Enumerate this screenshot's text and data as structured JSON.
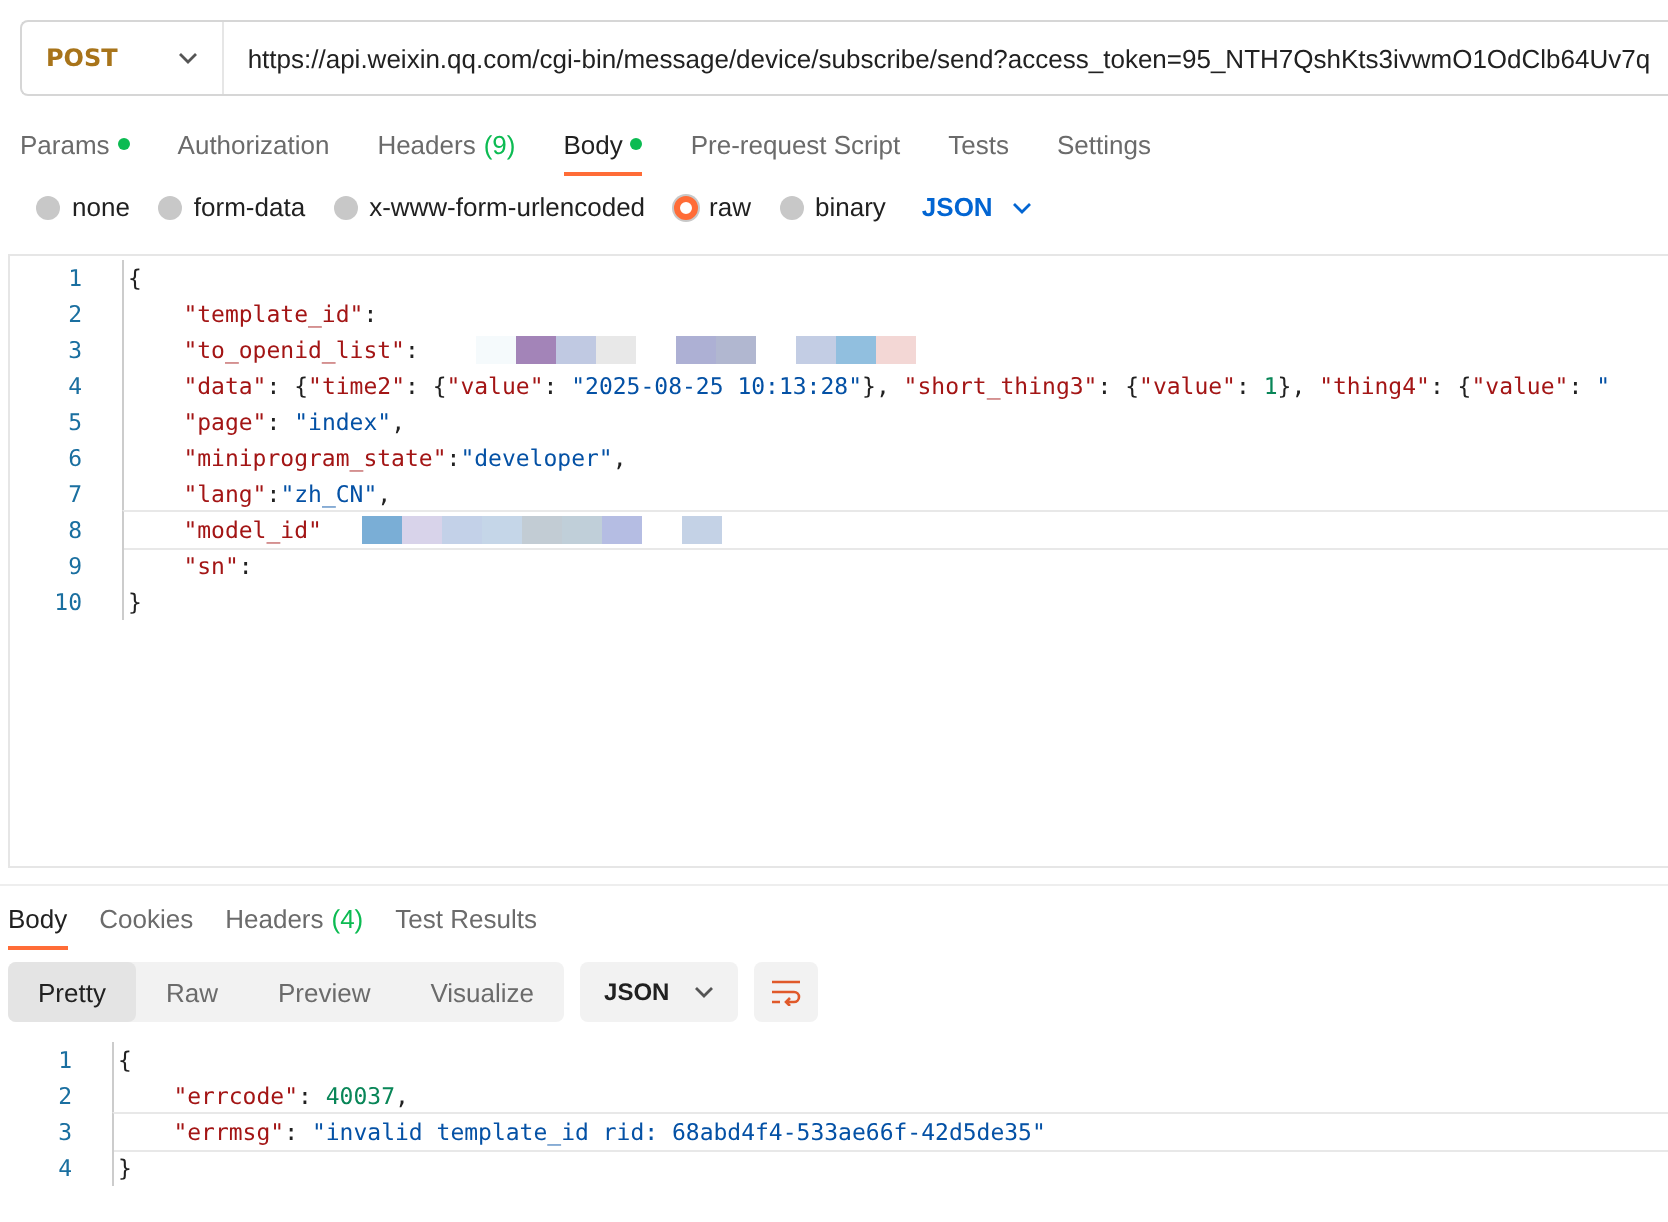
{
  "request": {
    "method": "POST",
    "url": "https://api.weixin.qq.com/cgi-bin/message/device/subscribe/send?access_token=95_NTH7QshKts3ivwmO1OdClb64Uv7q"
  },
  "request_tabs": [
    {
      "label": "Params",
      "dot": true,
      "selected": false
    },
    {
      "label": "Authorization",
      "dot": false,
      "selected": false
    },
    {
      "label": "Headers",
      "count": "(9)",
      "dot": false,
      "selected": false
    },
    {
      "label": "Body",
      "dot": true,
      "selected": true
    },
    {
      "label": "Pre-request Script",
      "dot": false,
      "selected": false
    },
    {
      "label": "Tests",
      "dot": false,
      "selected": false
    },
    {
      "label": "Settings",
      "dot": false,
      "selected": false
    }
  ],
  "body_types": [
    {
      "label": "none",
      "selected": false
    },
    {
      "label": "form-data",
      "selected": false
    },
    {
      "label": "x-www-form-urlencoded",
      "selected": false
    },
    {
      "label": "raw",
      "selected": true
    },
    {
      "label": "binary",
      "selected": false
    }
  ],
  "body_format": "JSON",
  "editor_lines": [
    {
      "number": "1",
      "current": false,
      "tokens": [
        {
          "kind": "punct",
          "text": "{"
        }
      ]
    },
    {
      "number": "2",
      "current": false,
      "tokens": [
        {
          "kind": "key",
          "text": "    \"template_id\""
        },
        {
          "kind": "punct",
          "text": ":"
        }
      ]
    },
    {
      "number": "3",
      "current": false,
      "tokens": [
        {
          "kind": "key",
          "text": "    \"to_openid_list\""
        },
        {
          "kind": "punct",
          "text": ": "
        },
        {
          "kind": "redacted"
        }
      ]
    },
    {
      "number": "4",
      "current": false,
      "tokens": [
        {
          "kind": "key",
          "text": "    \"data\""
        },
        {
          "kind": "punct",
          "text": ": {"
        },
        {
          "kind": "key",
          "text": "\"time2\""
        },
        {
          "kind": "punct",
          "text": ": {"
        },
        {
          "kind": "key",
          "text": "\"value\""
        },
        {
          "kind": "punct",
          "text": ": "
        },
        {
          "kind": "string",
          "text": "\"2025-08-25 10:13:28\""
        },
        {
          "kind": "punct",
          "text": "}, "
        },
        {
          "kind": "key",
          "text": "\"short_thing3\""
        },
        {
          "kind": "punct",
          "text": ": {"
        },
        {
          "kind": "key",
          "text": "\"value\""
        },
        {
          "kind": "punct",
          "text": ": "
        },
        {
          "kind": "number",
          "text": "1"
        },
        {
          "kind": "punct",
          "text": "}, "
        },
        {
          "kind": "key",
          "text": "\"thing4\""
        },
        {
          "kind": "punct",
          "text": ": {"
        },
        {
          "kind": "key",
          "text": "\"value\""
        },
        {
          "kind": "punct",
          "text": ": "
        },
        {
          "kind": "string",
          "text": "\""
        }
      ]
    },
    {
      "number": "5",
      "current": false,
      "tokens": [
        {
          "kind": "key",
          "text": "    \"page\""
        },
        {
          "kind": "punct",
          "text": ": "
        },
        {
          "kind": "string",
          "text": "\"index\""
        },
        {
          "kind": "punct",
          "text": ","
        }
      ]
    },
    {
      "number": "6",
      "current": false,
      "tokens": [
        {
          "kind": "key",
          "text": "    \"miniprogram_state\""
        },
        {
          "kind": "punct",
          "text": ":"
        },
        {
          "kind": "string",
          "text": "\"developer\""
        },
        {
          "kind": "punct",
          "text": ","
        }
      ]
    },
    {
      "number": "7",
      "current": false,
      "tokens": [
        {
          "kind": "key",
          "text": "    \"lang\""
        },
        {
          "kind": "punct",
          "text": ":"
        },
        {
          "kind": "string",
          "text": "\"zh_CN\""
        },
        {
          "kind": "punct",
          "text": ","
        }
      ]
    },
    {
      "number": "8",
      "current": true,
      "tokens": [
        {
          "kind": "key",
          "text": "    \"model_id\""
        },
        {
          "kind": "redacted"
        }
      ]
    },
    {
      "number": "9",
      "current": false,
      "tokens": [
        {
          "kind": "key",
          "text": "    \"sn\""
        },
        {
          "kind": "punct",
          "text": ":"
        }
      ]
    },
    {
      "number": "10",
      "current": false,
      "tokens": [
        {
          "kind": "punct",
          "text": "}"
        }
      ]
    }
  ],
  "response_tabs": [
    {
      "label": "Body",
      "selected": true
    },
    {
      "label": "Cookies",
      "selected": false
    },
    {
      "label": "Headers",
      "count": "(4)",
      "selected": false
    },
    {
      "label": "Test Results",
      "selected": false
    }
  ],
  "view_modes": [
    {
      "label": "Pretty",
      "selected": true
    },
    {
      "label": "Raw",
      "selected": false
    },
    {
      "label": "Preview",
      "selected": false
    },
    {
      "label": "Visualize",
      "selected": false
    }
  ],
  "response_format": "JSON",
  "response_lines": [
    {
      "number": "1",
      "current": false,
      "tokens": [
        {
          "kind": "punct",
          "text": "{"
        }
      ]
    },
    {
      "number": "2",
      "current": false,
      "tokens": [
        {
          "kind": "key",
          "text": "    \"errcode\""
        },
        {
          "kind": "punct",
          "text": ": "
        },
        {
          "kind": "number",
          "text": "40037"
        },
        {
          "kind": "punct",
          "text": ","
        }
      ]
    },
    {
      "number": "3",
      "current": true,
      "tokens": [
        {
          "kind": "key",
          "text": "    \"errmsg\""
        },
        {
          "kind": "punct",
          "text": ": "
        },
        {
          "kind": "string",
          "text": "\"invalid template_id rid: 68abd4f4-533ae66f-42d5de35\""
        }
      ]
    },
    {
      "number": "4",
      "current": false,
      "tokens": [
        {
          "kind": "punct",
          "text": "}"
        }
      ]
    }
  ]
}
